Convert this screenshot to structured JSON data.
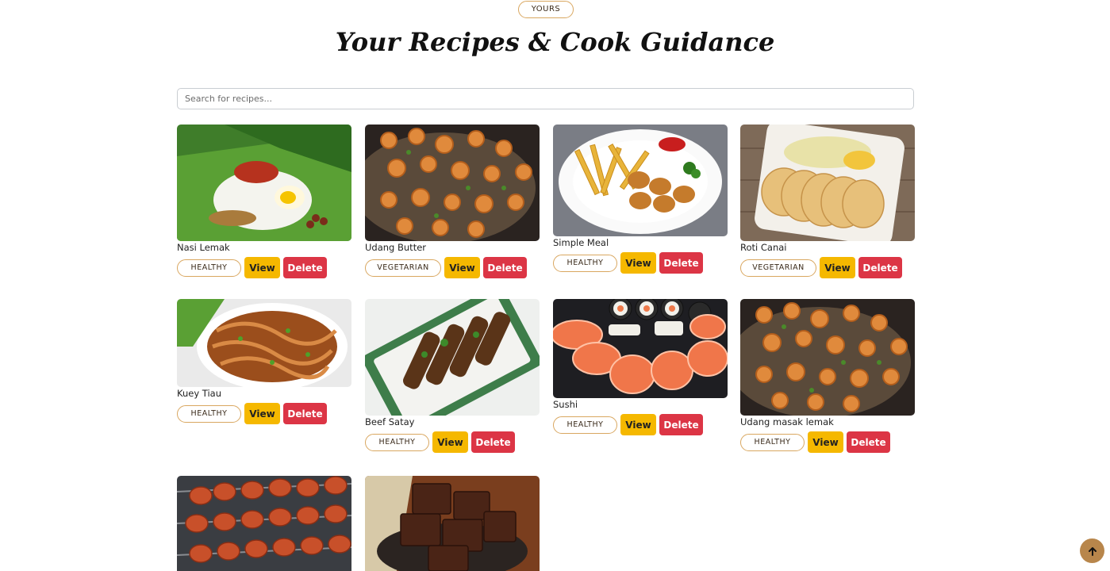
{
  "header": {
    "badge": "YOURS",
    "title": "Your Recipes & Cook Guidance"
  },
  "search": {
    "placeholder": "Search for recipes...",
    "value": ""
  },
  "buttons": {
    "view": "View",
    "delete": "Delete"
  },
  "recipes": [
    {
      "name": "Nasi Lemak",
      "tag": "HEALTHY",
      "image": "nasi-lemak-photo"
    },
    {
      "name": "Udang Butter",
      "tag": "VEGETARIAN",
      "image": "prawn-dish-photo"
    },
    {
      "name": "Simple Meal",
      "tag": "HEALTHY",
      "image": "fries-nuggets-photo"
    },
    {
      "name": "Roti Canai",
      "tag": "VEGETARIAN",
      "image": "roti-canai-photo"
    },
    {
      "name": "Kuey Tiau",
      "tag": "HEALTHY",
      "image": "fried-noodles-photo"
    },
    {
      "name": "Beef Satay",
      "tag": "HEALTHY",
      "image": "beef-satay-photo"
    },
    {
      "name": "Sushi",
      "tag": "HEALTHY",
      "image": "sushi-photo"
    },
    {
      "name": "Udang masak lemak",
      "tag": "HEALTHY",
      "image": "prawn-dish-photo"
    },
    {
      "name": "",
      "tag": "",
      "image": "chicken-skewers-photo"
    },
    {
      "name": "",
      "tag": "",
      "image": "brownies-photo"
    }
  ],
  "icons": {
    "scroll_top": "arrow-up-icon"
  },
  "colors": {
    "accent_tag_border": "#d9a760",
    "view_button": "#f5b800",
    "delete_button": "#dc3545",
    "scroll_top_button": "#b8864b"
  }
}
